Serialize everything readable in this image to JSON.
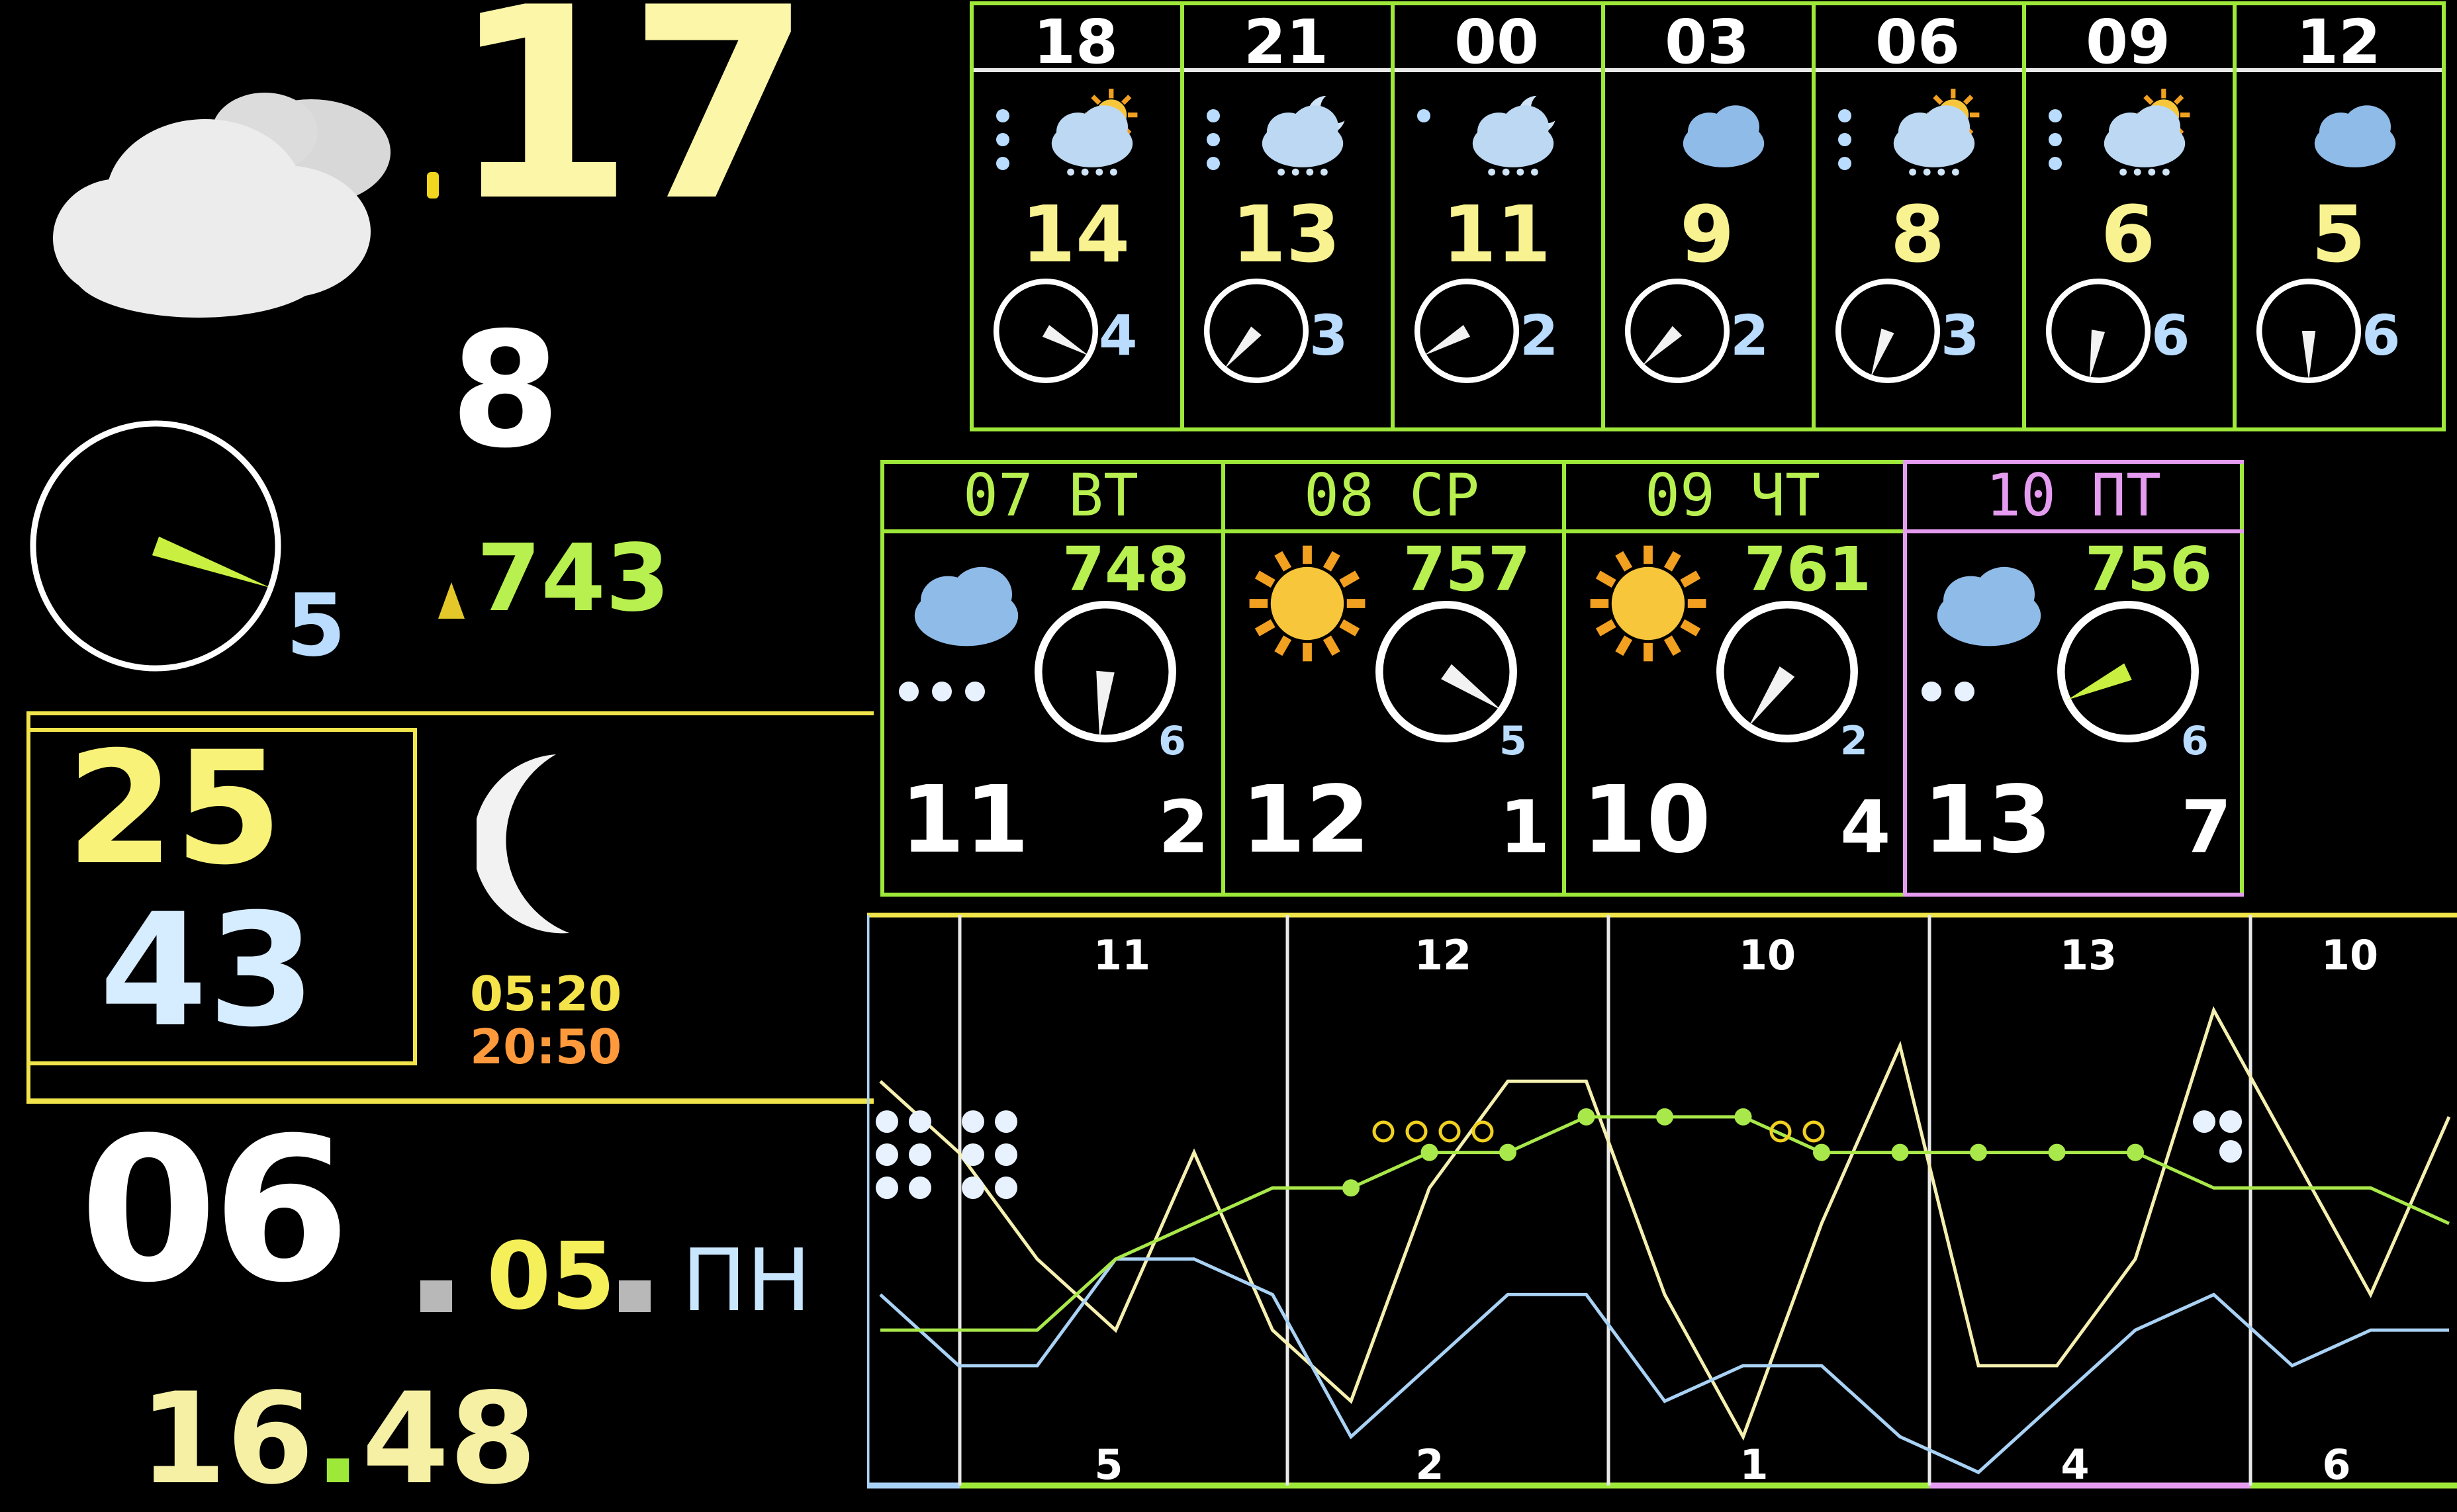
{
  "current": {
    "temperature": "17",
    "wind_speed": "8",
    "wind_scale": "5",
    "pressure": "743",
    "wind_dir_deg": 110,
    "icon": "cloud-icon"
  },
  "humidity": {
    "value1": "25",
    "value2": "43"
  },
  "sun": {
    "sunrise": "05:20",
    "sunset": "20:50",
    "moon_icon": "moon-crescent-icon"
  },
  "date": {
    "day": "06",
    "month": "05",
    "weekday": "ПН"
  },
  "clock": {
    "hours": "16",
    "minutes": "48",
    "separator": "."
  },
  "hourly": [
    {
      "hour": "18",
      "temp": "14",
      "wind": "4",
      "icon": "sun-cloud-rain-icon",
      "precip": 3,
      "dir": 120
    },
    {
      "hour": "21",
      "temp": "13",
      "wind": "3",
      "icon": "moon-cloud-rain-icon",
      "precip": 3,
      "dir": 220
    },
    {
      "hour": "00",
      "temp": "11",
      "wind": "2",
      "icon": "moon-cloud-rain-icon",
      "precip": 1,
      "dir": 240
    },
    {
      "hour": "03",
      "temp": "9",
      "wind": "2",
      "icon": "cloud-icon",
      "precip": 0,
      "dir": 225
    },
    {
      "hour": "06",
      "temp": "8",
      "wind": "3",
      "icon": "sun-cloud-rain-icon",
      "precip": 3,
      "dir": 200
    },
    {
      "hour": "09",
      "temp": "6",
      "wind": "6",
      "icon": "sun-cloud-rain-icon",
      "precip": 3,
      "dir": 190
    },
    {
      "hour": "12",
      "temp": "5",
      "wind": "6",
      "icon": "cloud-icon",
      "precip": 0,
      "dir": 180
    }
  ],
  "daily": [
    {
      "day": "07",
      "weekday": "ВТ",
      "pressure": "748",
      "tmax": "11",
      "tmin": "2",
      "wind": "6",
      "icon": "cloud-icon",
      "precip": 3,
      "dir": 185,
      "head_color": "#b8f050"
    },
    {
      "day": "08",
      "weekday": "СР",
      "pressure": "757",
      "tmax": "12",
      "tmin": "1",
      "wind": "5",
      "icon": "sun-icon",
      "precip": 0,
      "dir": 125,
      "head_color": "#b8f050"
    },
    {
      "day": "09",
      "weekday": "ЧТ",
      "pressure": "761",
      "tmax": "10",
      "tmin": "4",
      "wind": "2",
      "icon": "sun-icon",
      "precip": 0,
      "dir": 215,
      "head_color": "#b8f050"
    },
    {
      "day": "10",
      "weekday": "ПТ",
      "pressure": "756",
      "tmax": "13",
      "tmin": "7",
      "wind": "6",
      "icon": "cloud-icon",
      "precip": 2,
      "dir": 245,
      "head_color": "#e59cf0"
    }
  ],
  "chart_data": {
    "type": "line",
    "top_labels": [
      "11",
      "12",
      "10",
      "13",
      "10"
    ],
    "bottom_labels": [
      "5",
      "2",
      "1",
      "4",
      "6"
    ],
    "series": [
      {
        "color": "#f6f0b0",
        "values": [
          11,
          9,
          6,
          4,
          9,
          4,
          2,
          8,
          11,
          11,
          5,
          1,
          7,
          12,
          3,
          3,
          6,
          13,
          9,
          5,
          10
        ]
      },
      {
        "color": "#a9d2f5",
        "values": [
          5,
          3,
          3,
          6,
          6,
          5,
          1,
          3,
          5,
          5,
          2,
          3,
          3,
          1,
          0,
          2,
          4,
          5,
          3,
          4,
          4
        ]
      },
      {
        "color": "#a9e84a",
        "values": [
          4,
          4,
          4,
          6,
          7,
          8,
          8,
          9,
          9,
          10,
          10,
          10,
          9,
          9,
          9,
          9,
          9,
          8,
          8,
          8,
          7
        ]
      }
    ],
    "colors": {
      "frame": "#f0e44a",
      "grid": "#e8e8e8",
      "today": "#a9d2f5",
      "friday": "#e59cf0"
    }
  }
}
